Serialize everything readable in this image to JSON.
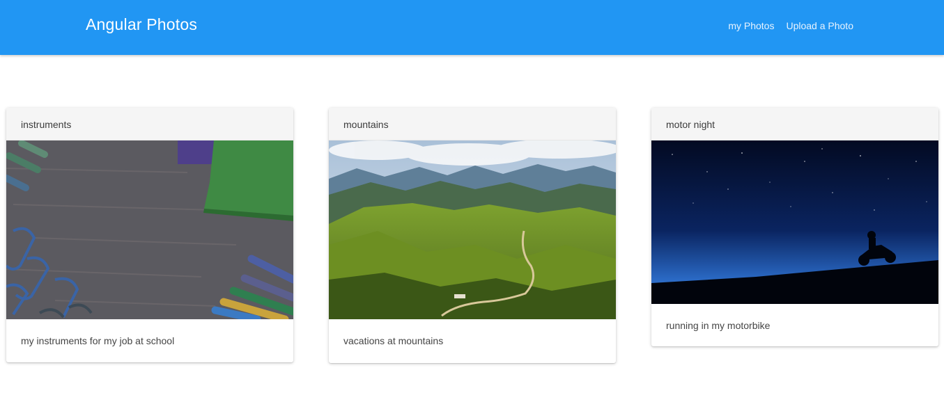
{
  "app": {
    "brand": "Angular Photos",
    "nav": [
      {
        "label": "my Photos"
      },
      {
        "label": "Upload a Photo"
      }
    ]
  },
  "photos": [
    {
      "title": "instruments",
      "description": "my instruments for my job at school",
      "image": "pencils-and-notebooks-on-desk"
    },
    {
      "title": "mountains",
      "description": "vacations at mountains",
      "image": "green-mountain-valley"
    },
    {
      "title": "motor night",
      "description": "running in my motorbike",
      "image": "motorbike-silhouette-night-sky"
    }
  ],
  "colors": {
    "navbar": "#2196f3",
    "card_header": "#f5f5f5",
    "background": "#ffffff"
  }
}
